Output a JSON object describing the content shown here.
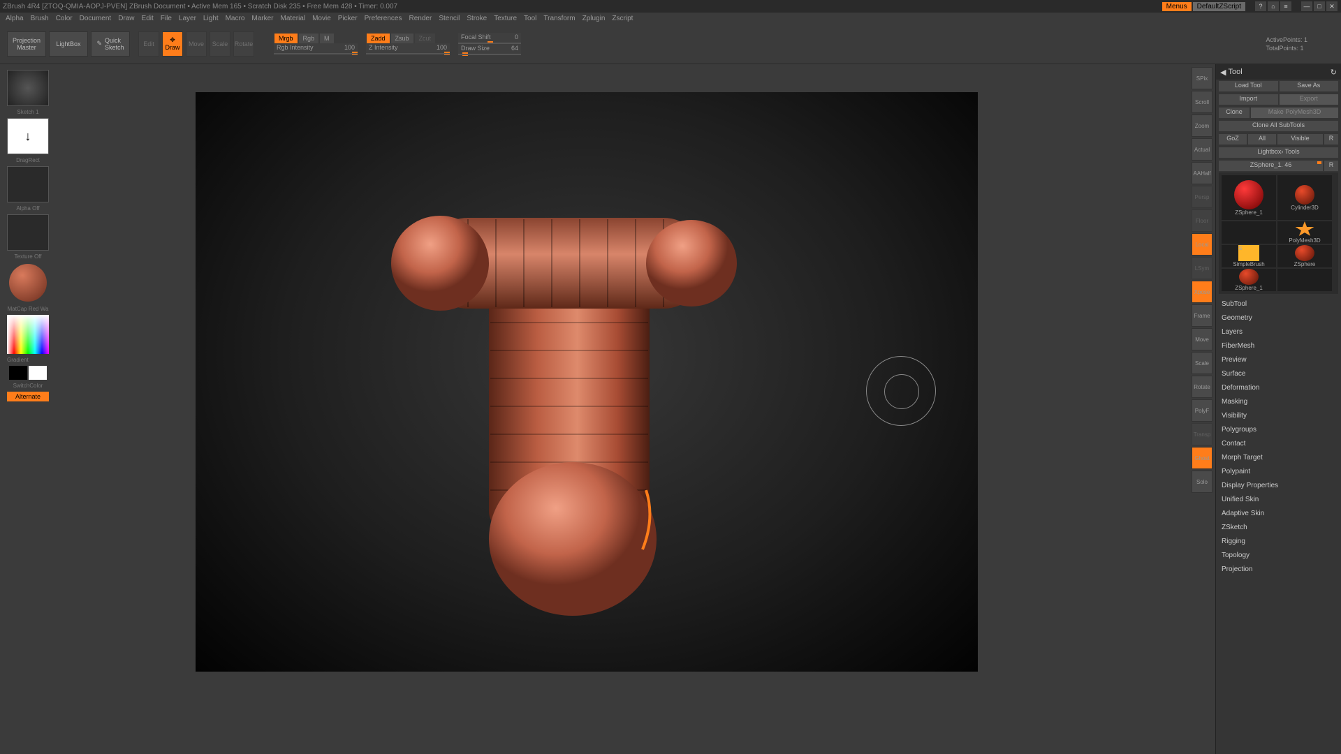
{
  "title": "ZBrush 4R4 [ZTOQ-QMIA-AOPJ-PVEN]    ZBrush Document    •  Active Mem 165  •  Scratch Disk 235  •  Free Mem 428  •  Timer: 0.007",
  "header_buttons": {
    "menus": "Menus",
    "script": "DefaultZScript"
  },
  "menus": [
    "Alpha",
    "Brush",
    "Color",
    "Document",
    "Draw",
    "Edit",
    "File",
    "Layer",
    "Light",
    "Macro",
    "Marker",
    "Material",
    "Movie",
    "Picker",
    "Preferences",
    "Render",
    "Stencil",
    "Stroke",
    "Texture",
    "Tool",
    "Transform",
    "Zplugin",
    "Zscript"
  ],
  "toolbar": {
    "projection": "Projection\nMaster",
    "lightbox": "LightBox",
    "quicksketch": "Quick\nSketch",
    "edit": "Edit",
    "draw": "Draw",
    "move": "Move",
    "scale": "Scale",
    "rotate": "Rotate",
    "mrgb": "Mrgb",
    "rgb": "Rgb",
    "m": "M",
    "zadd": "Zadd",
    "zsub": "Zsub",
    "zcut": "Zcut",
    "rgb_intensity_label": "Rgb Intensity",
    "rgb_intensity_val": "100",
    "z_intensity_label": "Z Intensity",
    "z_intensity_val": "100",
    "focal_shift_label": "Focal Shift",
    "focal_shift_val": "0",
    "draw_size_label": "Draw Size",
    "draw_size_val": "64",
    "active_points": "ActivePoints: 1",
    "total_points": "TotalPoints: 1"
  },
  "left": {
    "brush_label": "Sketch 1",
    "stroke_label": "DragRect",
    "alpha_label": "Alpha Off",
    "texture_label": "Texture Off",
    "material_label": "MatCap Red Wa",
    "gradient": "Gradient",
    "switchcolor": "SwitchColor",
    "alternate": "Alternate"
  },
  "viewport_buttons": [
    "SPix",
    "Scroll",
    "Zoom",
    "Actual",
    "AAHalf",
    "Persp",
    "Floor",
    "Local",
    "LSym",
    "Xpose",
    "Frame",
    "Move",
    "Scale",
    "Rotate",
    "PolyF",
    "Transp",
    "Ghost",
    "Solo"
  ],
  "tool_panel": {
    "header": "Tool",
    "load": "Load Tool",
    "saveas": "Save As",
    "import": "Import",
    "export": "Export",
    "clone": "Clone",
    "makepoly": "Make PolyMesh3D",
    "cloneall": "Clone All SubTools",
    "goz": "GoZ",
    "all": "All",
    "visible": "Visible",
    "r1": "R",
    "lightbox_tools": "Lightbox› Tools",
    "toolname": "ZSphere_1. 46",
    "r2": "R",
    "tools": [
      "ZSphere_1",
      "Cylinder3D",
      "",
      "PolyMesh3D",
      "SimpleBrush",
      "ZSphere",
      "ZSphere_1",
      ""
    ],
    "sections": [
      "SubTool",
      "Geometry",
      "Layers",
      "FiberMesh",
      "Preview",
      "Surface",
      "Deformation",
      "Masking",
      "Visibility",
      "Polygroups",
      "Contact",
      "Morph Target",
      "Polypaint",
      "Display Properties",
      "Unified Skin",
      "Adaptive Skin",
      "ZSketch",
      "Rigging",
      "Topology",
      "Projection"
    ]
  }
}
